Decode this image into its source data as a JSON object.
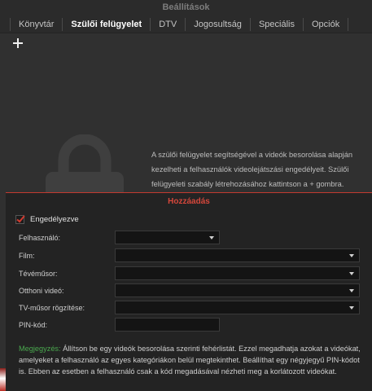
{
  "window": {
    "title": "Beállítások"
  },
  "tabs": [
    {
      "label": "Könyvtár",
      "active": false
    },
    {
      "label": "Szülői felügyelet",
      "active": true
    },
    {
      "label": "DTV",
      "active": false
    },
    {
      "label": "Jogosultság",
      "active": false
    },
    {
      "label": "Speciális",
      "active": false
    },
    {
      "label": "Opciók",
      "active": false
    }
  ],
  "main": {
    "add_icon": "plus-icon",
    "lock_icon": "lock-icon",
    "info_text": "A szülői felügyelet segítségével a videók besorolása alapján kezelheti a felhasználók videolejátszási engedélyeit. Szülői felügyeleti szabály létrehozásához kattintson a + gombra."
  },
  "dialog": {
    "title": "Hozzáadás",
    "enabled_label": "Engedélyezve",
    "enabled_checked": true,
    "fields": {
      "user": {
        "label": "Felhasználó:",
        "value": ""
      },
      "film": {
        "label": "Film:",
        "value": ""
      },
      "tv_show": {
        "label": "Tévéműsor:",
        "value": ""
      },
      "home_video": {
        "label": "Otthoni videó:",
        "value": ""
      },
      "tv_recording": {
        "label": "TV-műsor rögzítése:",
        "value": ""
      },
      "pin": {
        "label": "PIN-kód:",
        "value": ""
      }
    },
    "note_label": "Megjegyzés:",
    "note_text": " Állítson be egy videók besorolása szerinti fehérlistát. Ezzel megadhatja azokat a videókat, amelyeket a felhasználó az egyes kategóriákon belül megtekinthet. Beállíthat egy négyjegyű PIN-kódot is. Ebben az esetben a felhasználó csak a kód megadásával nézheti meg a korlátozott videókat."
  },
  "colors": {
    "accent_red": "#d5473b",
    "note_green": "#4aa84e",
    "background": "#303030",
    "dialog_bg": "#232323"
  }
}
